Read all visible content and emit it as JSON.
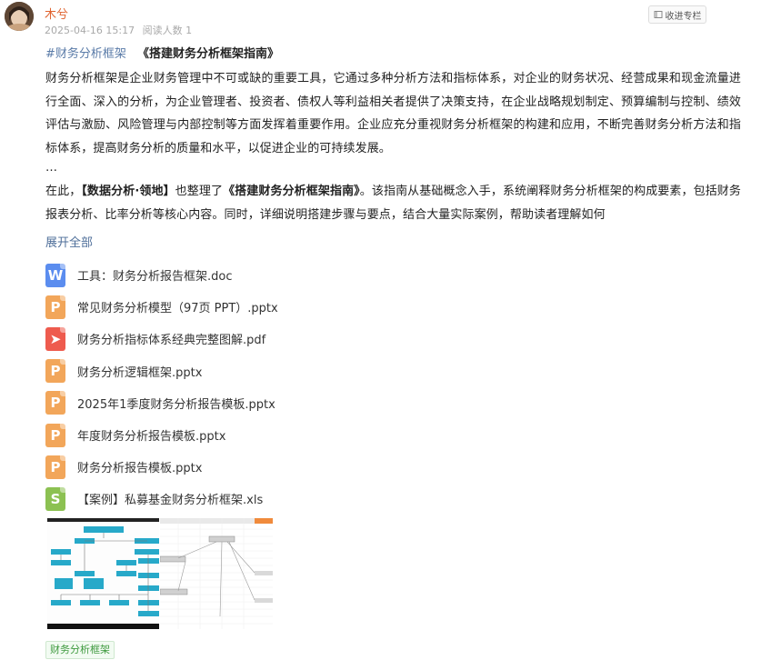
{
  "post": {
    "author": "木兮",
    "date": "2025-04-16 15:17",
    "read_count": "阅读人数 1",
    "collect_button": "收进专栏"
  },
  "content": {
    "topic_tag": "#财务分析框架",
    "title": "《搭建财务分析框架指南》",
    "paragraph1": "财务分析框架是企业财务管理中不可或缺的重要工具，它通过多种分析方法和指标体系，对企业的财务状况、经营成果和现金流量进行全面、深入的分析，为企业管理者、投资者、债权人等利益相关者提供了决策支持，在企业战略规划制定、预算编制与控制、绩效评估与激励、风险管理与内部控制等方面发挥着重要作用。企业应充分重视财务分析框架的构建和应用，不断完善财务分析方法和指标体系，提高财务分析的质量和水平，以促进企业的可持续发展。",
    "ellipsis": "…",
    "paragraph2_prefix": "在此，",
    "paragraph2_source": "【数据分析·领地】",
    "paragraph2_mid": "也整理了",
    "paragraph2_title": "《搭建财务分析框架指南》",
    "paragraph2_rest": "。该指南从基础概念入手，系统阐释财务分析框架的构成要素，包括财务报表分析、比率分析等核心内容。同时，详细说明搭建步骤与要点，结合大量实际案例，帮助读者理解如何",
    "expand_all": "展开全部"
  },
  "attachments": [
    {
      "name": "工具：财务分析报告框架.doc",
      "icon": "word-icon",
      "letter": "W",
      "color": "#5b8def"
    },
    {
      "name": "常见财务分析模型（97页 PPT）.pptx",
      "icon": "ppt-icon",
      "letter": "P",
      "color": "#f2a65a"
    },
    {
      "name": "财务分析指标体系经典完整图解.pdf",
      "icon": "pdf-icon",
      "letter": "➤",
      "color": "#ee5b4e"
    },
    {
      "name": "财务分析逻辑框架.pptx",
      "icon": "ppt-icon",
      "letter": "P",
      "color": "#f2a65a"
    },
    {
      "name": "2025年1季度财务分析报告模板.pptx",
      "icon": "ppt-icon",
      "letter": "P",
      "color": "#f2a65a"
    },
    {
      "name": "年度财务分析报告模板.pptx",
      "icon": "ppt-icon",
      "letter": "P",
      "color": "#f2a65a"
    },
    {
      "name": "财务分析报告模板.pptx",
      "icon": "ppt-icon",
      "letter": "P",
      "color": "#f2a65a"
    },
    {
      "name": "【案例】私募基金财务分析框架.xls",
      "icon": "excel-icon",
      "letter": "S",
      "color": "#8cc152"
    }
  ],
  "tags": [
    "财务分析框架"
  ],
  "colors": {
    "author": "#e0632f",
    "topic": "#5a7ba8",
    "link": "#4f6f9a",
    "tag": "#3f9a3f"
  }
}
